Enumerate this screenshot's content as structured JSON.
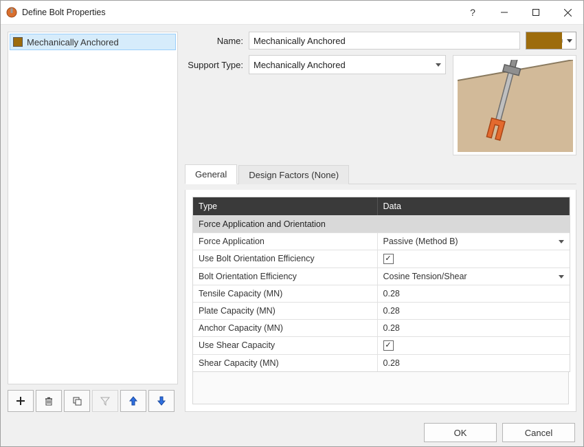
{
  "title": "Define Bolt Properties",
  "brand_color": "#9d6c0c",
  "sidebar": {
    "items": [
      {
        "label": "Mechanically Anchored",
        "selected": true
      }
    ]
  },
  "toolbar": {
    "add": "add-button",
    "delete": "delete-button",
    "duplicate": "duplicate-button",
    "filter": "filter-button",
    "move_up": "move-up-button",
    "move_down": "move-down-button"
  },
  "fields": {
    "name_label": "Name:",
    "name_value": "Mechanically Anchored",
    "support_type_label": "Support Type:",
    "support_type_value": "Mechanically Anchored"
  },
  "tabs": {
    "general": "General",
    "design_factors": "Design Factors (None)"
  },
  "grid": {
    "col_type": "Type",
    "col_data": "Data",
    "section1": "Force Application and Orientation",
    "rows": [
      {
        "label": "Force Application",
        "value": "Passive (Method B)",
        "kind": "select"
      },
      {
        "label": "Use Bolt Orientation Efficiency",
        "value": true,
        "kind": "check"
      },
      {
        "label": "Bolt Orientation Efficiency",
        "value": "Cosine Tension/Shear",
        "kind": "select"
      },
      {
        "label": "Tensile Capacity (MN)",
        "value": "0.28",
        "kind": "text"
      },
      {
        "label": "Plate Capacity (MN)",
        "value": "0.28",
        "kind": "text"
      },
      {
        "label": "Anchor Capacity (MN)",
        "value": "0.28",
        "kind": "text"
      },
      {
        "label": "Use Shear Capacity",
        "value": true,
        "kind": "check"
      },
      {
        "label": "Shear Capacity (MN)",
        "value": "0.28",
        "kind": "text"
      }
    ]
  },
  "footer": {
    "ok": "OK",
    "cancel": "Cancel"
  }
}
